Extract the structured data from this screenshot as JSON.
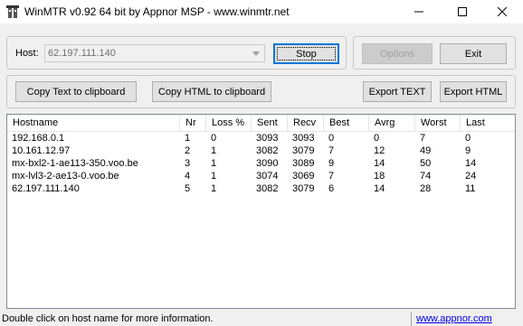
{
  "window": {
    "title": "WinMTR v0.92 64 bit by Appnor MSP - www.winmtr.net"
  },
  "host": {
    "label": "Host:",
    "value": "62.197.111.140"
  },
  "buttons": {
    "stop": "Stop",
    "options": "Options",
    "exit": "Exit",
    "copy_text": "Copy Text to clipboard",
    "copy_html": "Copy HTML to clipboard",
    "export_text": "Export TEXT",
    "export_html": "Export HTML"
  },
  "table": {
    "columns": [
      "Hostname",
      "Nr",
      "Loss %",
      "Sent",
      "Recv",
      "Best",
      "Avrg",
      "Worst",
      "Last"
    ],
    "rows": [
      [
        "192.168.0.1",
        "1",
        "0",
        "3093",
        "3093",
        "0",
        "0",
        "7",
        "0"
      ],
      [
        "10.161.12.97",
        "2",
        "1",
        "3082",
        "3079",
        "7",
        "12",
        "49",
        "9"
      ],
      [
        "mx-bxl2-1-ae113-350.voo.be",
        "3",
        "1",
        "3090",
        "3089",
        "9",
        "14",
        "50",
        "14"
      ],
      [
        "mx-lvl3-2-ae13-0.voo.be",
        "4",
        "1",
        "3074",
        "3069",
        "7",
        "18",
        "74",
        "24"
      ],
      [
        "62.197.111.140",
        "5",
        "1",
        "3082",
        "3079",
        "6",
        "14",
        "28",
        "11"
      ]
    ]
  },
  "status": {
    "text": "Double click on host name for more information.",
    "link": "www.appnor.com"
  },
  "icons": {
    "app": "winmtr-icon",
    "minimize": "minimize-icon",
    "maximize": "maximize-icon",
    "close": "close-icon",
    "dropdown": "chevron-down-icon"
  }
}
